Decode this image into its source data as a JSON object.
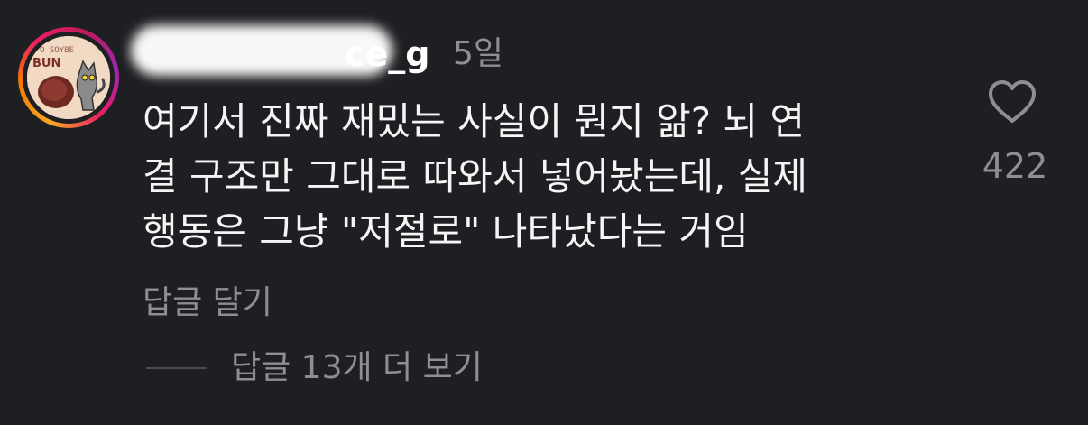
{
  "comment": {
    "username_visible": "ce_g",
    "time": "5일",
    "body_lines": [
      "여기서 진짜 재밌는 사실이 뭔지 앎? 뇌 연",
      "결 구조만 그대로 따와서 넣어놨는데, 실제",
      "행동은 그냥 \"저절로\" 나타났다는 거임"
    ],
    "like_count": "422",
    "reply_label": "답글 달기",
    "view_replies_label": "답글 13개 더 보기",
    "avatar_text": "SOYBE BUN"
  },
  "icons": {
    "like": "heart-outline-icon"
  },
  "colors": {
    "background": "#1e1f22",
    "muted_text": "#8e8e93",
    "ring_gradient": [
      "#f9a825",
      "#e91e63",
      "#9c27b0"
    ]
  }
}
